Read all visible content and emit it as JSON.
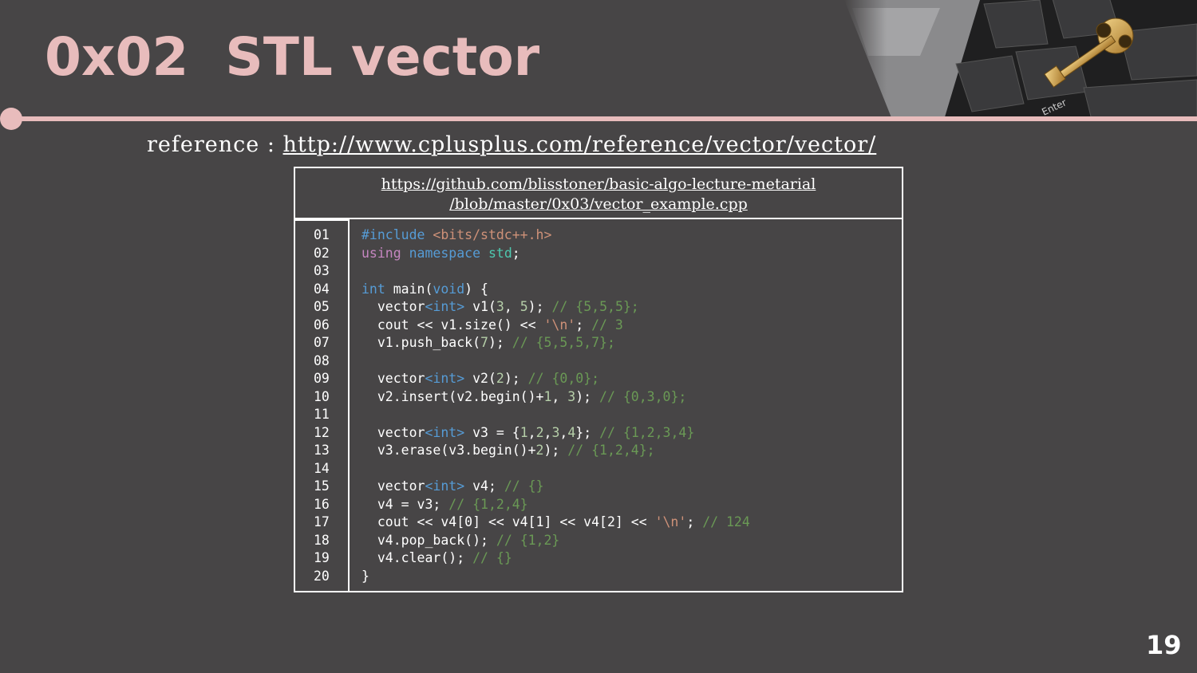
{
  "slide": {
    "title": "0x02  STL vector",
    "reference_label": "reference :",
    "reference_url": "http://www.cplusplus.com/reference/vector/vector/",
    "page_number": "19"
  },
  "code": {
    "source_line1": "https://github.com/blisstoner/basic-algo-lecture-metarial",
    "source_line2": "/blob/master/0x03/vector_example.cpp",
    "line_numbers": [
      "01",
      "02",
      "03",
      "04",
      "05",
      "06",
      "07",
      "08",
      "09",
      "10",
      "11",
      "12",
      "13",
      "14",
      "15",
      "16",
      "17",
      "18",
      "19",
      "20"
    ],
    "lines": [
      [
        [
          "kw-b",
          "#include "
        ],
        [
          "str",
          "<bits/stdc++.h>"
        ]
      ],
      [
        [
          "kw-p",
          "using "
        ],
        [
          "kw-b",
          "namespace "
        ],
        [
          "ty",
          "std"
        ],
        [
          "",
          "; "
        ]
      ],
      [],
      [
        [
          "kw-b",
          "int "
        ],
        [
          "",
          "main("
        ],
        [
          "kw-b",
          "void"
        ],
        [
          "",
          ") {"
        ]
      ],
      [
        [
          "",
          "  vector"
        ],
        [
          "kw-b",
          "<int> "
        ],
        [
          "",
          "v1("
        ],
        [
          "num",
          "3"
        ],
        [
          "",
          ", "
        ],
        [
          "num",
          "5"
        ],
        [
          "",
          "); "
        ],
        [
          "cmt",
          "// {5,5,5};"
        ]
      ],
      [
        [
          "",
          "  cout << v1.size() << "
        ],
        [
          "str",
          "'\\n'"
        ],
        [
          "",
          "; "
        ],
        [
          "cmt",
          "// 3"
        ]
      ],
      [
        [
          "",
          "  v1.push_back("
        ],
        [
          "num",
          "7"
        ],
        [
          "",
          "); "
        ],
        [
          "cmt",
          "// {5,5,5,7};"
        ]
      ],
      [],
      [
        [
          "",
          "  vector"
        ],
        [
          "kw-b",
          "<int> "
        ],
        [
          "",
          "v2("
        ],
        [
          "num",
          "2"
        ],
        [
          "",
          "); "
        ],
        [
          "cmt",
          "// {0,0};"
        ]
      ],
      [
        [
          "",
          "  v2.insert(v2.begin()+"
        ],
        [
          "num",
          "1"
        ],
        [
          "",
          ", "
        ],
        [
          "num",
          "3"
        ],
        [
          "",
          "); "
        ],
        [
          "cmt",
          "// {0,3,0};"
        ]
      ],
      [],
      [
        [
          "",
          "  vector"
        ],
        [
          "kw-b",
          "<int> "
        ],
        [
          "",
          "v3 = {"
        ],
        [
          "num",
          "1"
        ],
        [
          "",
          ","
        ],
        [
          "num",
          "2"
        ],
        [
          "",
          ","
        ],
        [
          "num",
          "3"
        ],
        [
          "",
          ","
        ],
        [
          "num",
          "4"
        ],
        [
          "",
          "}; "
        ],
        [
          "cmt",
          "// {1,2,3,4}"
        ]
      ],
      [
        [
          "",
          "  v3.erase(v3.begin()+"
        ],
        [
          "num",
          "2"
        ],
        [
          "",
          "); "
        ],
        [
          "cmt",
          "// {1,2,4};"
        ]
      ],
      [],
      [
        [
          "",
          "  vector"
        ],
        [
          "kw-b",
          "<int> "
        ],
        [
          "",
          "v4; "
        ],
        [
          "cmt",
          "// {}"
        ]
      ],
      [
        [
          "",
          "  v4 = v3; "
        ],
        [
          "cmt",
          "// {1,2,4}"
        ]
      ],
      [
        [
          "",
          "  cout << v4[0] << v4[1] << v4[2] << "
        ],
        [
          "str",
          "'\\n'"
        ],
        [
          "",
          "; "
        ],
        [
          "cmt",
          "// 124"
        ]
      ],
      [
        [
          "",
          "  v4.pop_back(); "
        ],
        [
          "cmt",
          "// {1,2}"
        ]
      ],
      [
        [
          "",
          "  v4.clear(); "
        ],
        [
          "cmt",
          "// {}"
        ]
      ],
      [
        [
          "",
          "}"
        ]
      ]
    ]
  }
}
